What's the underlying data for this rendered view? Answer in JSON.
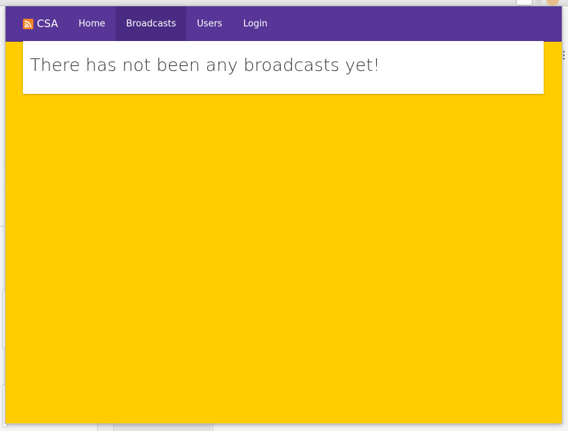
{
  "navbar": {
    "brand_label": "CSA",
    "brand_icon": "rss-icon",
    "links": [
      {
        "label": "Home",
        "active": false
      },
      {
        "label": "Broadcasts",
        "active": true
      },
      {
        "label": "Users",
        "active": false
      },
      {
        "label": "Login",
        "active": false
      }
    ]
  },
  "main": {
    "message": "There has not been any broadcasts yet!"
  },
  "colors": {
    "navbar": "#583698",
    "navbar_active": "#4a2b83",
    "page_background": "#ffcc00",
    "panel": "#ffffff",
    "rss_icon": "#f78422"
  }
}
